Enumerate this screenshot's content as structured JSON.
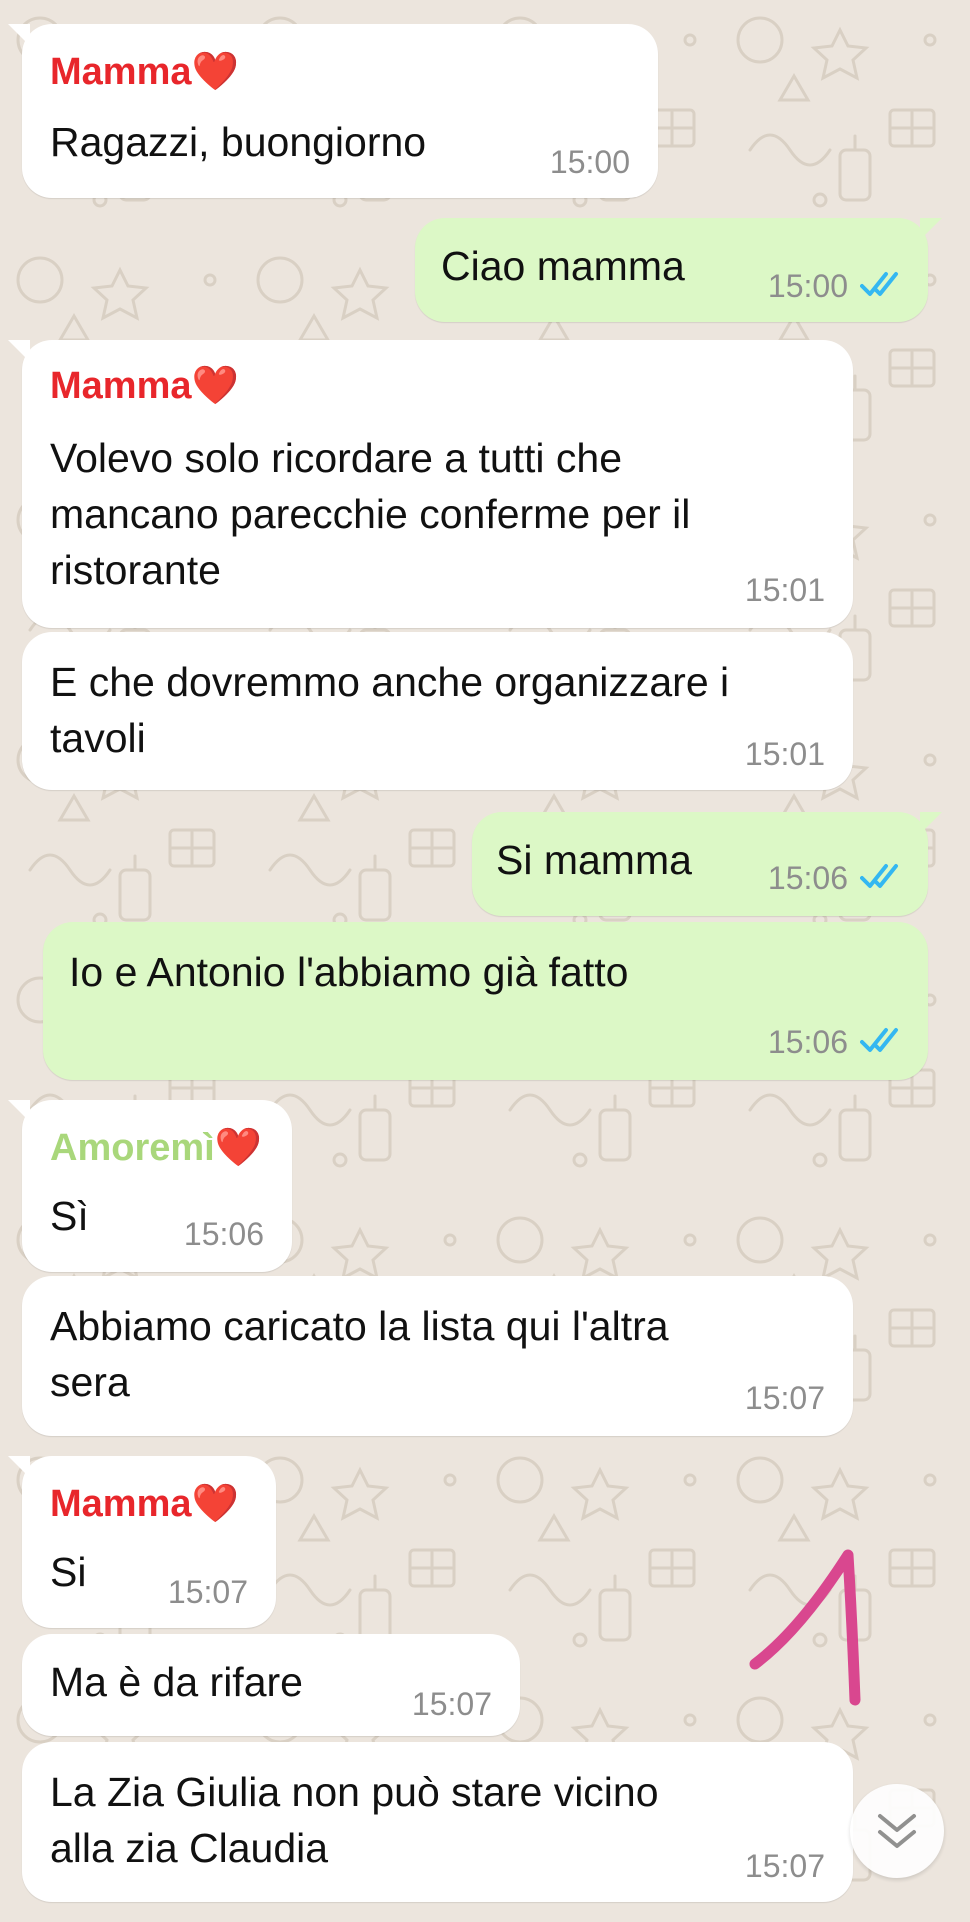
{
  "chat": {
    "messages": [
      {
        "sender": "Mamma",
        "heart": "❤️",
        "text": "Ragazzi, buongiorno",
        "time": "15:00"
      },
      {
        "text": "Ciao mamma",
        "time": "15:00"
      },
      {
        "sender": "Mamma",
        "heart": "❤️",
        "text": "Volevo solo ricordare a tutti che\nmancano parecchie conferme per il\nristorante",
        "time": "15:01"
      },
      {
        "text": "E che dovremmo anche organizzare i\ntavoli",
        "time": "15:01"
      },
      {
        "text": "Si mamma",
        "time": "15:06"
      },
      {
        "text": "Io e Antonio l'abbiamo già fatto",
        "time": "15:06"
      },
      {
        "sender": "Amoremì",
        "heart": "❤️",
        "text": "Sì",
        "time": "15:06"
      },
      {
        "text": "Abbiamo caricato la lista qui l'altra\nsera",
        "time": "15:07"
      },
      {
        "sender": "Mamma",
        "heart": "❤️",
        "text": "Si",
        "time": "15:07"
      },
      {
        "text": "Ma è da rifare",
        "time": "15:07"
      },
      {
        "text": "La Zia Giulia non può stare vicino\nalla zia Claudia",
        "time": "15:07"
      }
    ]
  },
  "colors": {
    "background": "#ece5dd",
    "incoming_bubble": "#ffffff",
    "outgoing_bubble": "#dcf8c6",
    "mamma_name": "#e8262b",
    "amoremi_name": "#a9d77b",
    "read_ticks": "#34b7f1",
    "annotation_stroke": "#d9478f"
  },
  "icons": {
    "read_receipt": "double-check-icon",
    "scroll_down": "chevron-down-icon",
    "annotation": "handwritten-number-one"
  }
}
